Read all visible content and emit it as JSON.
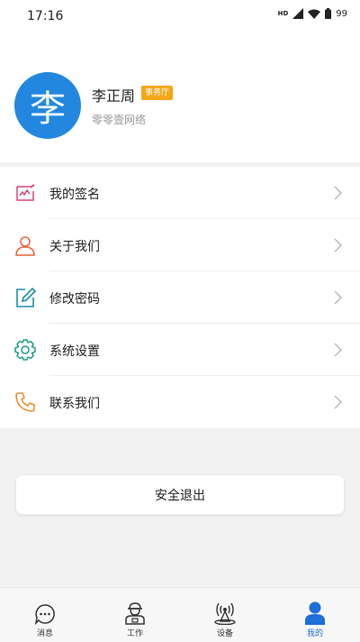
{
  "status_bar": {
    "time": "17:16",
    "network": "HD",
    "battery": "99"
  },
  "profile": {
    "avatar_char": "李",
    "name": "李正周",
    "badge": "事务厅",
    "company": "零零壹网络"
  },
  "menu": [
    {
      "label": "我的签名",
      "icon": "signature-icon"
    },
    {
      "label": "关于我们",
      "icon": "user-icon"
    },
    {
      "label": "修改密码",
      "icon": "edit-icon"
    },
    {
      "label": "系统设置",
      "icon": "gear-icon"
    },
    {
      "label": "联系我们",
      "icon": "phone-icon"
    }
  ],
  "logout_label": "安全退出",
  "tabs": [
    {
      "label": "消息",
      "icon": "chat-icon",
      "active": false
    },
    {
      "label": "工作",
      "icon": "worker-icon",
      "active": false
    },
    {
      "label": "设备",
      "icon": "device-icon",
      "active": false
    },
    {
      "label": "我的",
      "icon": "person-icon",
      "active": true
    }
  ],
  "colors": {
    "accent": "#2387e0",
    "badge": "#f4a71a",
    "active_tab": "#1d6fd9"
  }
}
